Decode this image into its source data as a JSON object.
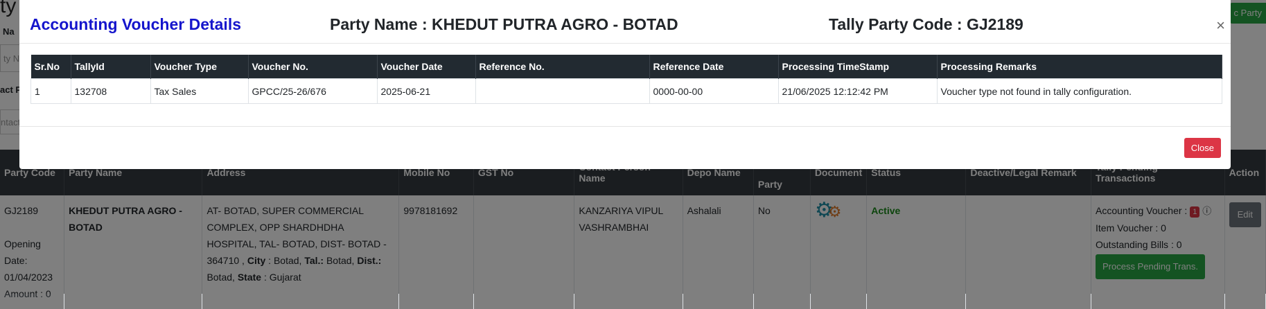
{
  "background": {
    "page_title_fragment": "ty",
    "top_right_button": "c Party",
    "frag_name_label": "Na",
    "frag_party_input": "ty N",
    "frag_contact_label": "act P",
    "frag_contact_input": "ntact",
    "table": {
      "headers": [
        "Party Code",
        "Party Name",
        "Address",
        "Mobile No",
        "GST No",
        "Contact Person Name",
        "Depo Name",
        "Party",
        "Document",
        "Status",
        "Deactive/Legal Remark",
        "Tally Pending Transactions",
        "Action"
      ],
      "row": {
        "party_code": "GJ2189",
        "opening_label": "Opening Date:",
        "opening_date": "01/04/2023",
        "amount_label": "Amount : 0",
        "party_name": "KHEDUT PUTRA AGRO - BOTAD",
        "address_main": "AT- BOTAD, SUPER COMMERCIAL COMPLEX, OPP SHARDHDHA HOSPITAL, TAL- BOTAD, DIST- BOTAD - 364710 ,",
        "city_label": "City",
        "city_value": ": Botad,",
        "tal_label": "Tal.:",
        "tal_value": "Botad,",
        "dist_label": "Dist.:",
        "dist_value": "Botad,",
        "state_label": "State",
        "state_value": ": Gujarat",
        "mobile": "9978181692",
        "gst": "",
        "contact_person": "KANZARIYA VIPUL VASHRAMBHAI",
        "depo": "Ashalali",
        "party_flag": "No",
        "status": "Active",
        "remark": "",
        "accounting_voucher": "Accounting Voucher :",
        "accounting_count": "1",
        "item_voucher": "Item Voucher : 0",
        "outstanding_bills": "Outstanding Bills : 0",
        "process_button": "Process Pending Trans.",
        "edit_button": "Edit"
      }
    }
  },
  "modal": {
    "title": "Accounting Voucher Details",
    "party_name": "Party Name : KHEDUT PUTRA AGRO - BOTAD",
    "party_code": "Tally Party Code : GJ2189",
    "close_icon": "×",
    "columns": [
      "Sr.No",
      "TallyId",
      "Voucher Type",
      "Voucher No.",
      "Voucher Date",
      "Reference No.",
      "Reference Date",
      "Processing TimeStamp",
      "Processing Remarks"
    ],
    "rows": [
      [
        "1",
        "132708",
        "Tax Sales",
        "GPCC/25-26/676",
        "2025-06-21",
        "",
        "0000-00-00",
        "21/06/2025 12:12:42 PM",
        "Voucher type not found in tally configuration."
      ]
    ],
    "close_button": "Close"
  }
}
